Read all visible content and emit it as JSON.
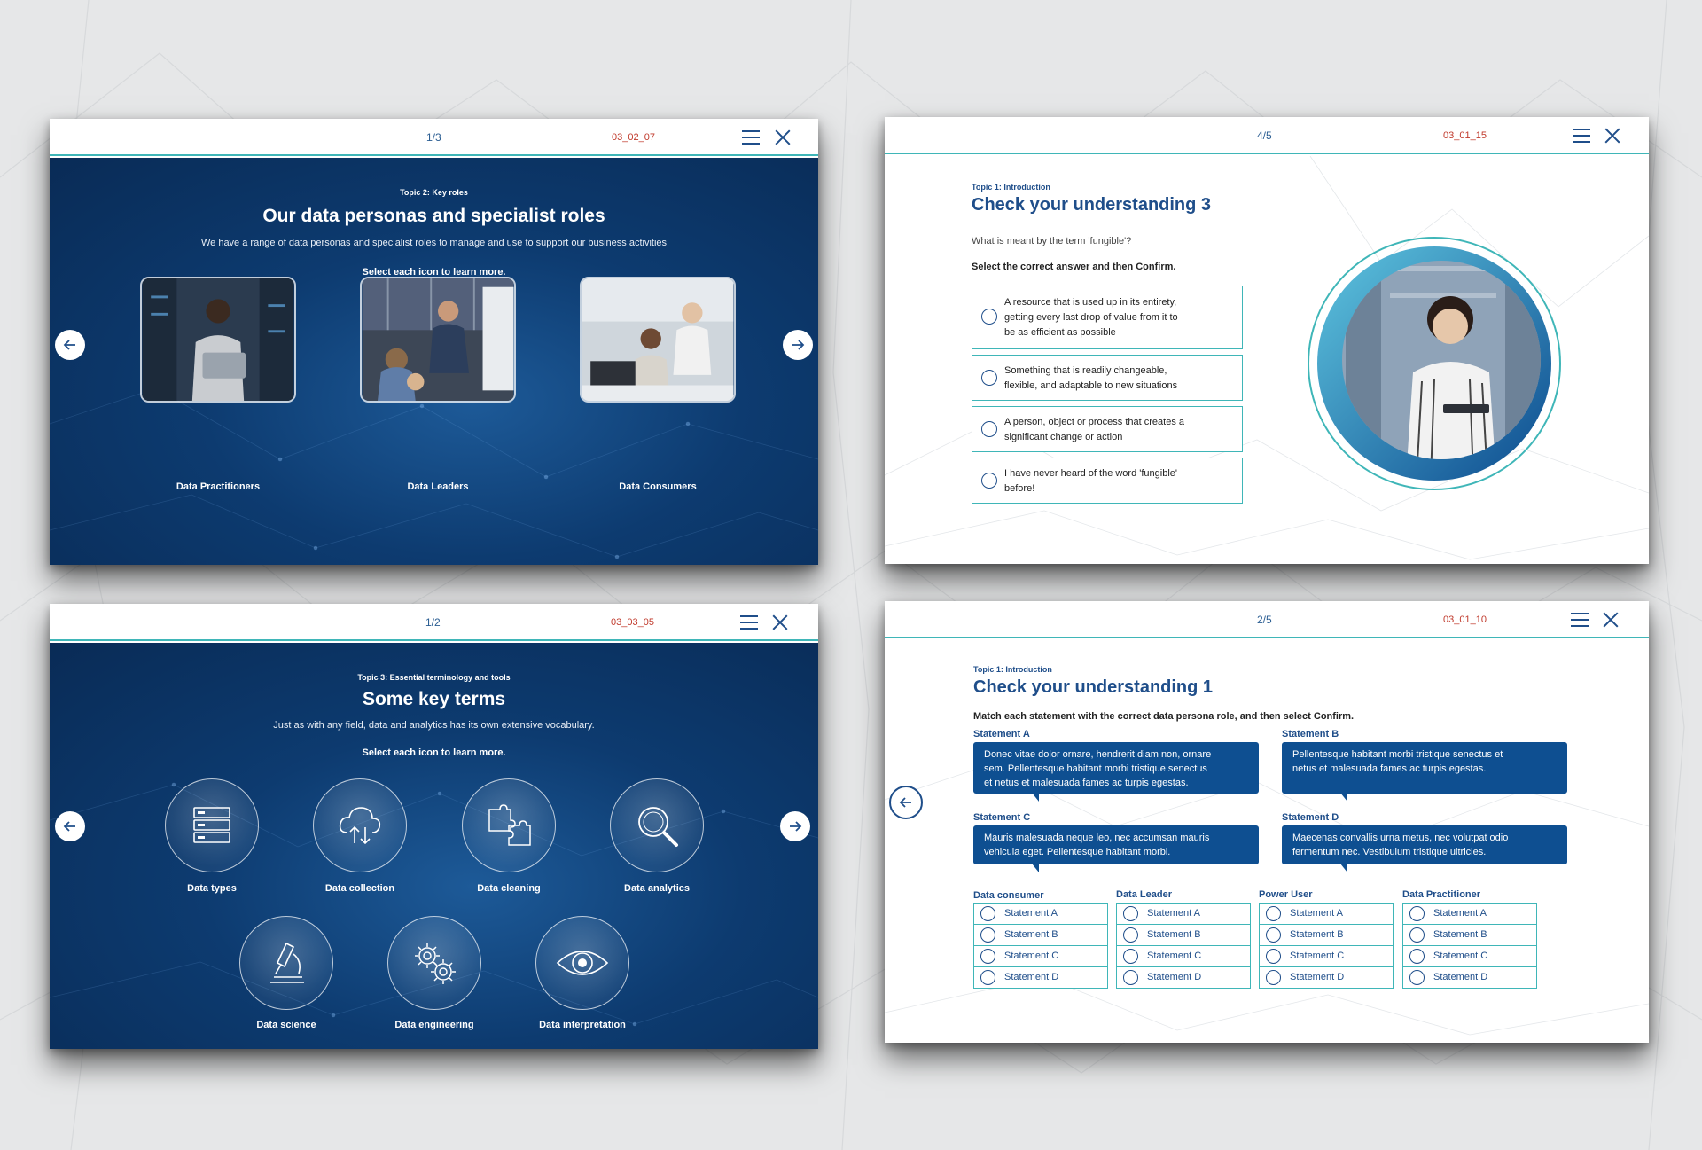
{
  "slide1": {
    "page": "1/3",
    "code": "03_02_07",
    "topic": "Topic 2: Key roles",
    "title": "Our data personas and specialist roles",
    "intro": "We have a range of data personas and specialist roles to manage and use to support our business activities",
    "select": "Select each icon to learn more.",
    "cards": [
      {
        "label": "Data Practitioners"
      },
      {
        "label": "Data Leaders"
      },
      {
        "label": "Data Consumers"
      }
    ]
  },
  "slide2": {
    "page": "4/5",
    "code": "03_01_15",
    "topic": "Topic 1: Introduction",
    "title": "Check your understanding 3",
    "question": "What is meant by the term 'fungible'?",
    "instruction": "Select the correct answer and then Confirm.",
    "options": [
      {
        "line1": "A resource that is used up in its entirety,",
        "line2": "getting every last drop of value from it to",
        "line3": "be as efficient as possible"
      },
      {
        "line1": "Something that is readily changeable,",
        "line2": "flexible, and adaptable to new situations"
      },
      {
        "line1": "A person, object or process that creates a",
        "line2": "significant change or action"
      },
      {
        "line1": "I have never heard of the word 'fungible'",
        "line2": "before!"
      }
    ]
  },
  "slide3": {
    "page": "1/2",
    "code": "03_03_05",
    "topic": "Topic 3: Essential terminology and tools",
    "title": "Some key terms",
    "intro": "Just as with any field, data and analytics has its own extensive vocabulary.",
    "select": "Select each icon to learn more.",
    "terms": [
      {
        "label": "Data types",
        "icon": "server-icon"
      },
      {
        "label": "Data collection",
        "icon": "cloud-upload-icon"
      },
      {
        "label": "Data cleaning",
        "icon": "puzzle-icon"
      },
      {
        "label": "Data analytics",
        "icon": "magnifier-icon"
      },
      {
        "label": "Data science",
        "icon": "microscope-icon"
      },
      {
        "label": "Data engineering",
        "icon": "gears-icon"
      },
      {
        "label": "Data interpretation",
        "icon": "eye-icon"
      }
    ]
  },
  "slide4": {
    "page": "2/5",
    "code": "03_01_10",
    "topic": "Topic 1: Introduction",
    "title": "Check your understanding 1",
    "instruction": "Match each statement with the correct data persona role, and then select Confirm.",
    "statements": [
      {
        "label": "Statement A",
        "line1": "Donec vitae dolor ornare, hendrerit diam non, ornare",
        "line2": "sem. Pellentesque habitant morbi tristique senectus",
        "line3": "et netus et malesuada fames ac turpis egestas."
      },
      {
        "label": "Statement B",
        "line1": "Pellentesque habitant morbi tristique senectus et",
        "line2": "netus et malesuada fames ac turpis egestas.",
        "line3": ""
      },
      {
        "label": "Statement C",
        "line1": "Mauris malesuada neque leo, nec accumsan mauris",
        "line2": "vehicula eget. Pellentesque habitant morbi.",
        "line3": ""
      },
      {
        "label": "Statement D",
        "line1": "Maecenas convallis urna metus, nec volutpat odio",
        "line2": "fermentum nec. Vestibulum tristique ultricies.",
        "line3": ""
      }
    ],
    "columns": [
      {
        "head": "Data consumer",
        "opts": [
          "Statement A",
          "Statement B",
          "Statement C",
          "Statement D"
        ]
      },
      {
        "head": "Data Leader",
        "opts": [
          "Statement A",
          "Statement B",
          "Statement C",
          "Statement D"
        ]
      },
      {
        "head": "Power User",
        "opts": [
          "Statement A",
          "Statement B",
          "Statement C",
          "Statement D"
        ]
      },
      {
        "head": "Data Practitioner",
        "opts": [
          "Statement A",
          "Statement B",
          "Statement C",
          "Statement D"
        ]
      }
    ]
  },
  "colors": {
    "navy": "#0d3b70",
    "brand_blue": "#1f4e8a",
    "teal": "#3fb6b8",
    "code_red": "#c0392b",
    "bubble_blue": "#0e4f91"
  }
}
